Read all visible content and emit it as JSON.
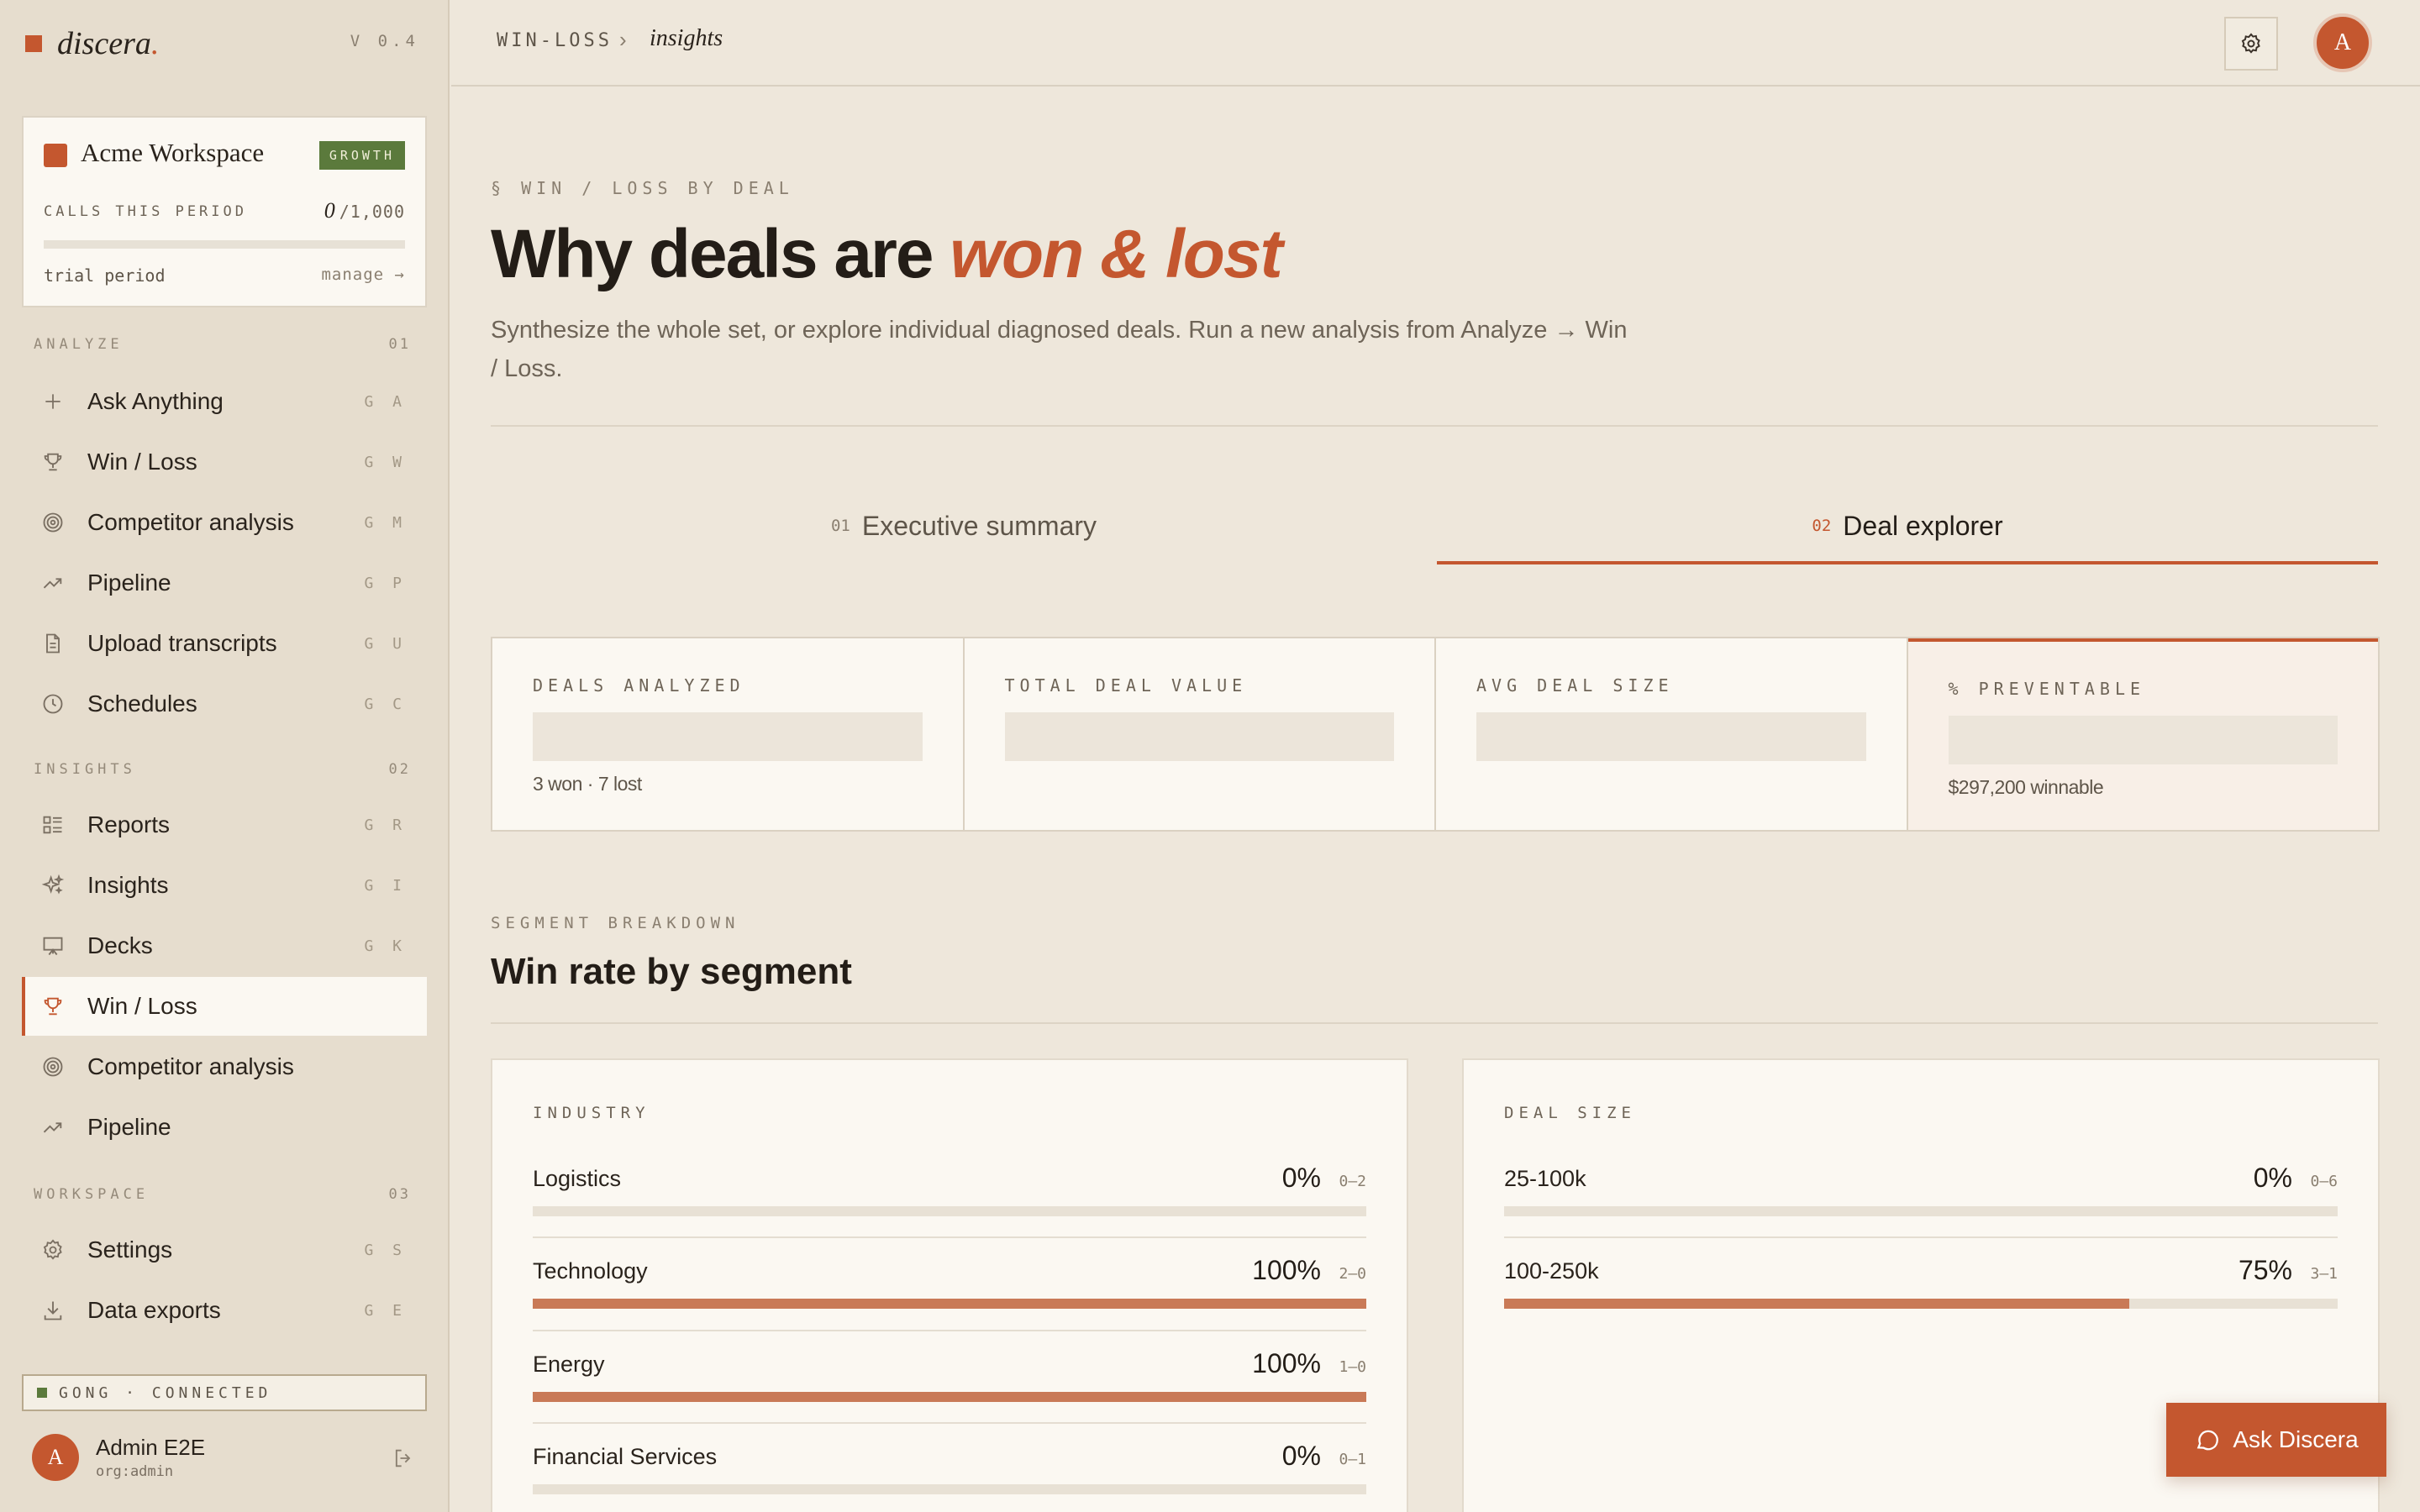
{
  "app": {
    "name": "discera",
    "name_dot": ".",
    "version": "V 0.4"
  },
  "workspace": {
    "name": "Acme Workspace",
    "plan": "GROWTH",
    "calls_label": "CALLS THIS PERIOD",
    "calls_used": "0",
    "calls_limit": "/1,000",
    "calls_progress": 0,
    "trial_label": "trial period",
    "manage_label": "manage →"
  },
  "sidebar": {
    "sections": [
      {
        "title": "ANALYZE",
        "num": "01"
      },
      {
        "title": "INSIGHTS",
        "num": "02"
      },
      {
        "title": "WORKSPACE",
        "num": "03"
      }
    ],
    "items": [
      {
        "label": "Ask Anything",
        "key": "G A",
        "icon": "plus-icon"
      },
      {
        "label": "Win / Loss",
        "key": "G W",
        "icon": "trophy-icon"
      },
      {
        "label": "Competitor analysis",
        "key": "G M",
        "icon": "target-icon"
      },
      {
        "label": "Pipeline",
        "key": "G P",
        "icon": "trending-up-icon"
      },
      {
        "label": "Upload transcripts",
        "key": "G U",
        "icon": "document-icon"
      },
      {
        "label": "Schedules",
        "key": "G C",
        "icon": "clock-icon"
      },
      {
        "label": "Reports",
        "key": "G R",
        "icon": "list-icon"
      },
      {
        "label": "Insights",
        "key": "G I",
        "icon": "sparkles-icon"
      },
      {
        "label": "Decks",
        "key": "G K",
        "icon": "presentation-icon"
      },
      {
        "label": "Win / Loss",
        "key": "",
        "icon": "trophy-icon",
        "active": true
      },
      {
        "label": "Competitor analysis",
        "key": "",
        "icon": "target-icon"
      },
      {
        "label": "Pipeline",
        "key": "",
        "icon": "trending-up-icon"
      },
      {
        "label": "Settings",
        "key": "G S",
        "icon": "gear-icon"
      },
      {
        "label": "Data exports",
        "key": "G E",
        "icon": "download-icon"
      }
    ],
    "integration": "GONG · CONNECTED",
    "user": {
      "initial": "A",
      "name": "Admin E2E",
      "org": "org:admin"
    }
  },
  "topbar": {
    "breadcrumb_root": "WIN-LOSS",
    "breadcrumb_sep": "›",
    "breadcrumb_current": "insights",
    "avatar_initial": "A"
  },
  "page": {
    "eyebrow": "§ WIN / LOSS BY DEAL",
    "title_plain": "Why deals are",
    "title_accent": "won & lost",
    "subtitle": "Synthesize the whole set, or explore individual diagnosed deals. Run a new analysis from Analyze → Win / Loss."
  },
  "tabs": [
    {
      "num": "01",
      "label": "Executive summary",
      "active": false
    },
    {
      "num": "02",
      "label": "Deal explorer",
      "active": true
    }
  ],
  "stats": [
    {
      "label": "DEALS ANALYZED",
      "sub": "3 won · 7 lost"
    },
    {
      "label": "TOTAL DEAL VALUE",
      "sub": ""
    },
    {
      "label": "AVG DEAL SIZE",
      "sub": ""
    },
    {
      "label": "% PREVENTABLE",
      "sub": "$297,200 winnable"
    }
  ],
  "segments": {
    "eyebrow": "SEGMENT BREAKDOWN",
    "title": "Win rate by segment",
    "industry": {
      "title": "INDUSTRY",
      "rows": [
        {
          "name": "Logistics",
          "pct": "0%",
          "record": "0–2",
          "rate": 0
        },
        {
          "name": "Technology",
          "pct": "100%",
          "record": "2–0",
          "rate": 1
        },
        {
          "name": "Energy",
          "pct": "100%",
          "record": "1–0",
          "rate": 1
        },
        {
          "name": "Financial Services",
          "pct": "0%",
          "record": "0–1",
          "rate": 0
        }
      ]
    },
    "deal_size": {
      "title": "DEAL SIZE",
      "rows": [
        {
          "name": "25-100k",
          "pct": "0%",
          "record": "0–6",
          "rate": 0
        },
        {
          "name": "100-250k",
          "pct": "75%",
          "record": "3–1",
          "rate": 0.75
        }
      ]
    }
  },
  "ask_button": {
    "label": "Ask Discera"
  },
  "colors": {
    "accent": "#C4572F",
    "success": "#5B7A3C",
    "bar": "#C97A57",
    "background": "#EEE7DB"
  }
}
